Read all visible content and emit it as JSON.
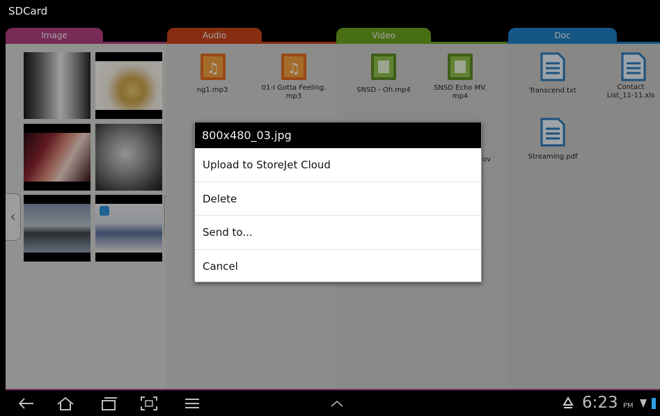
{
  "app": {
    "title": "SDCard"
  },
  "tabs": [
    {
      "label": "Image",
      "color": "#b0407f"
    },
    {
      "label": "Audio",
      "color": "#c8431a"
    },
    {
      "label": "Video",
      "color": "#6aa31d"
    },
    {
      "label": "Doc",
      "color": "#1f7fc4"
    }
  ],
  "audio_files": [
    {
      "name": "ng1.mp3",
      "icon": "music-folder-icon"
    },
    {
      "name": "01-I Gotta Feeling.\nmp3",
      "icon": "music-folder-icon"
    }
  ],
  "video_files": [
    {
      "name": "SNSD - Oh.mp4",
      "icon": "film-folder-icon"
    },
    {
      "name": "SNSD Echo MV.\nmp4",
      "icon": "film-folder-icon"
    },
    {
      "name": "ov",
      "icon": "film-folder-icon"
    }
  ],
  "doc_files": [
    {
      "name": "Transcend.txt",
      "icon": "document-icon"
    },
    {
      "name": "Contact\nList_11-11.xls",
      "icon": "document-icon"
    },
    {
      "name": "Streaming.pdf",
      "icon": "document-icon"
    }
  ],
  "dialog": {
    "title": "800x480_03.jpg",
    "items": [
      "Upload to StoreJet Cloud",
      "Delete",
      "Send to...",
      "Cancel"
    ]
  },
  "status": {
    "time": "6:23",
    "ampm": "PM"
  }
}
